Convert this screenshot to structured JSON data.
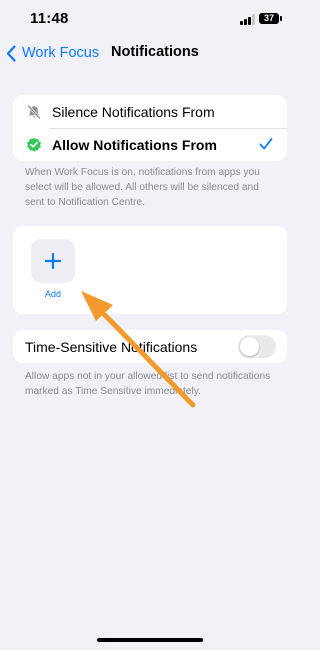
{
  "status_bar": {
    "time": "11:48",
    "battery": "37"
  },
  "nav": {
    "back_label": "Work Focus",
    "title": "Notifications"
  },
  "mode_group": {
    "items": [
      {
        "label": "Silence Notifications From",
        "icon": "bell-slash-icon",
        "selected": false
      },
      {
        "label": "Allow Notifications From",
        "icon": "checkmark-seal-icon",
        "selected": true
      }
    ],
    "footnote": "When Work Focus is on, notifications from apps you select will be allowed. All others will be silenced and sent to Notification Centre."
  },
  "apps_group": {
    "add_label": "Add"
  },
  "time_sensitive": {
    "label": "Time-Sensitive Notifications",
    "enabled": false,
    "footnote": "Allow apps not in your allowed list to send notifications marked as Time Sensitive immediately."
  },
  "colors": {
    "accent": "#0a7aff",
    "background": "#f2f1f7",
    "badge_green": "#34c759",
    "annotation_arrow": "#f29a2e"
  }
}
